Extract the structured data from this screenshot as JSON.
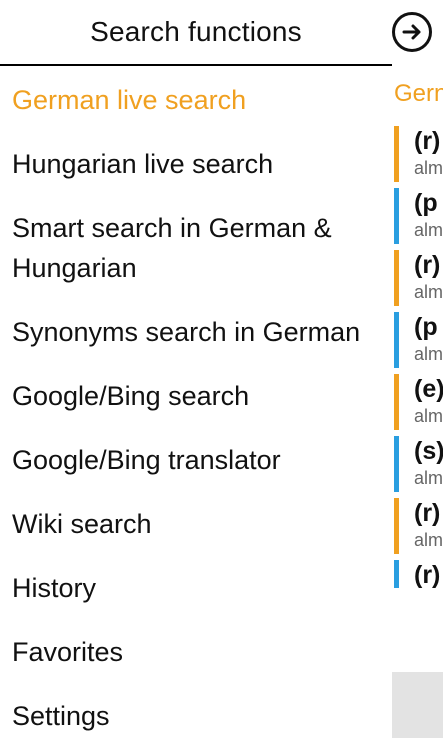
{
  "drawer": {
    "title": "Search functions",
    "items": [
      {
        "label": "German live search",
        "active": true
      },
      {
        "label": "Hungarian live search"
      },
      {
        "label": "Smart search in German &"
      },
      {
        "label": "Hungarian"
      },
      {
        "label": "Synonyms search in German"
      },
      {
        "label": "Google/Bing search"
      },
      {
        "label": "Google/Bing translator"
      },
      {
        "label": "Wiki search"
      },
      {
        "label": "History"
      },
      {
        "label": "Favorites"
      },
      {
        "label": "Settings"
      }
    ]
  },
  "content": {
    "forward_icon": "arrow-right-circle-icon",
    "section_title": "Gern",
    "results": [
      {
        "head": "(r)",
        "sub": "alm",
        "color": "#f0a020"
      },
      {
        "head": "(p",
        "sub": "alm",
        "color": "#2a9ee0"
      },
      {
        "head": "(r)",
        "sub": "alm",
        "color": "#f0a020"
      },
      {
        "head": "(p",
        "sub": "alm",
        "color": "#2a9ee0"
      },
      {
        "head": "(e)",
        "sub": "alm",
        "color": "#f0a020"
      },
      {
        "head": "(s)",
        "sub": "alm",
        "color": "#2a9ee0"
      },
      {
        "head": "(r)",
        "sub": "alm",
        "color": "#f0a020"
      },
      {
        "head": "(r)",
        "sub": "",
        "color": "#2a9ee0"
      }
    ]
  },
  "colors": {
    "accent": "#f0a020",
    "blue": "#2a9ee0",
    "gray_panel": "#e3e3e3"
  }
}
